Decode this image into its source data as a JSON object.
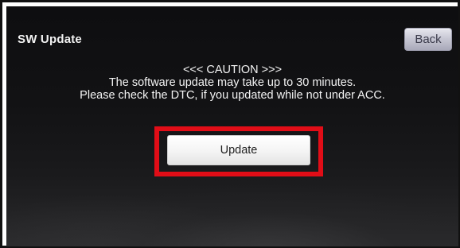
{
  "screen": {
    "title": "SW Update",
    "back_label": "Back"
  },
  "message": {
    "caution": "<<< CAUTION >>>",
    "line1": "The software update may take up to 30 minutes.",
    "line2": "Please check the DTC, if you updated while not under ACC."
  },
  "actions": {
    "update_label": "Update"
  },
  "colors": {
    "highlight": "#e10d17",
    "screen_background": "#121214",
    "text": "#f4f4f4"
  }
}
